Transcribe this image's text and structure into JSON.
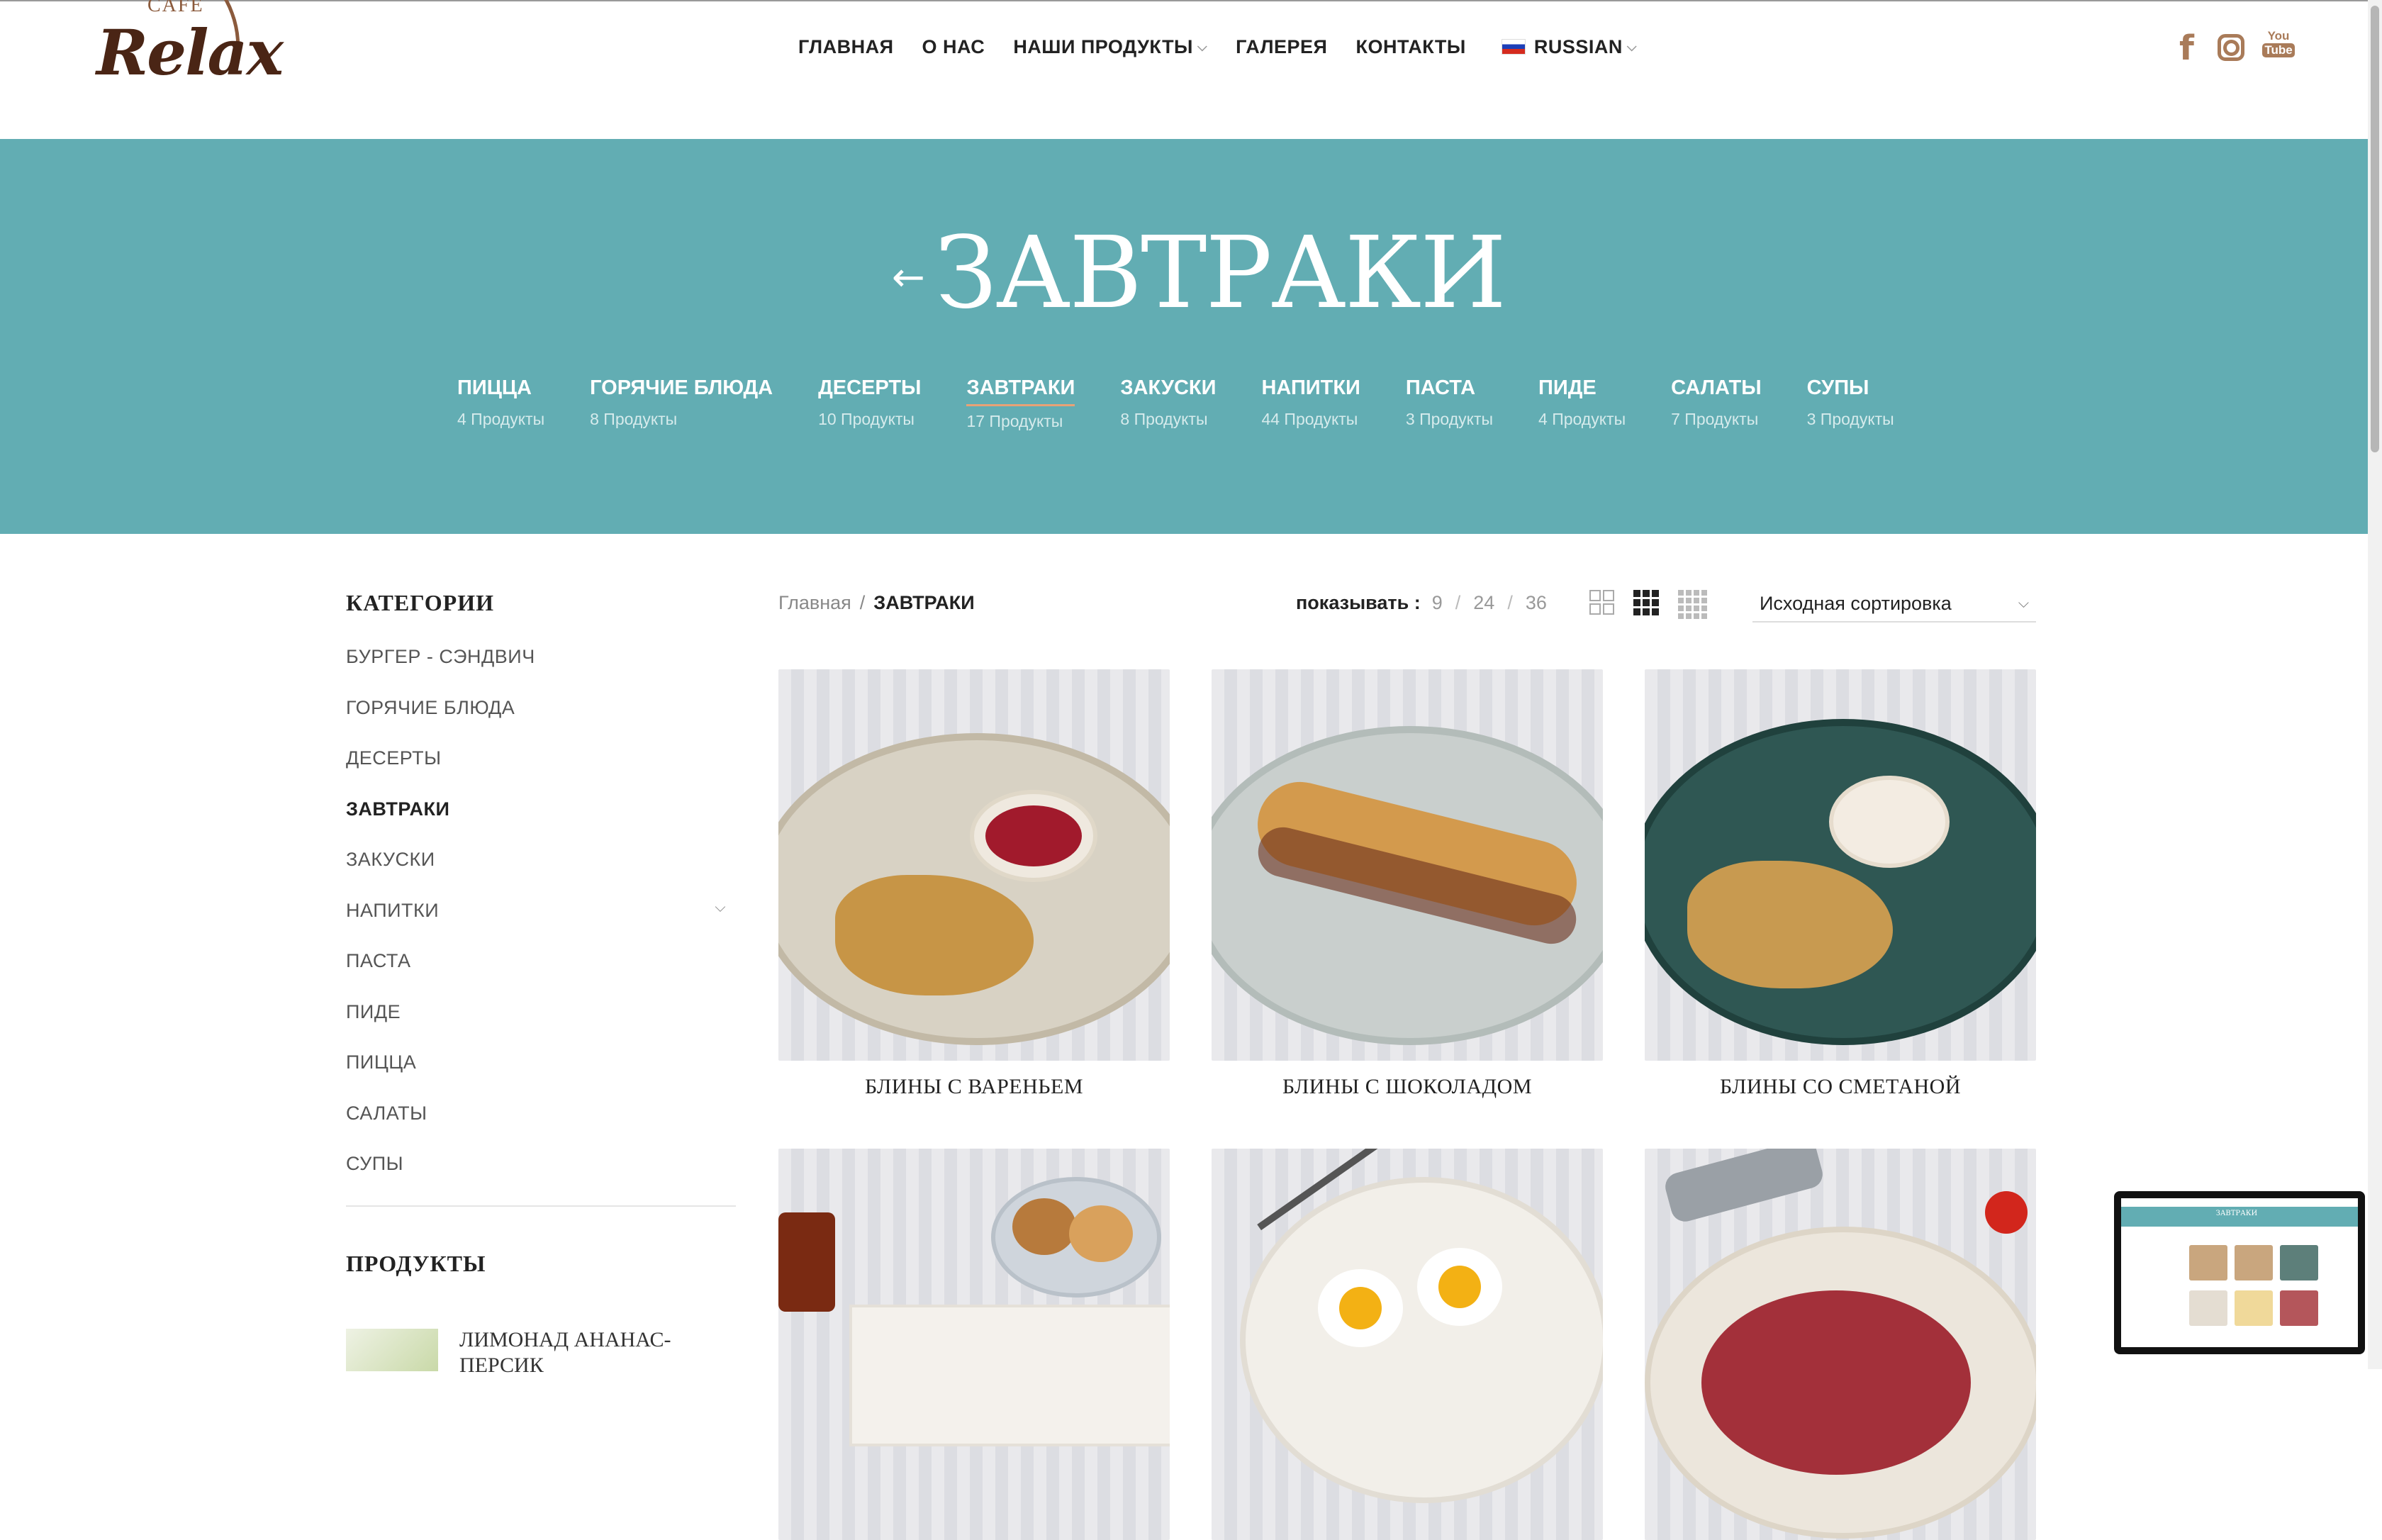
{
  "header": {
    "logo": {
      "cafe": "CAFE",
      "word": "Relax"
    },
    "nav": [
      {
        "label": "ГЛАВНАЯ",
        "has_dropdown": false
      },
      {
        "label": "О НАС",
        "has_dropdown": false
      },
      {
        "label": "НАШИ ПРОДУКТЫ",
        "has_dropdown": true
      },
      {
        "label": "ГАЛЕРЕЯ",
        "has_dropdown": false
      },
      {
        "label": "КОНТАКТЫ",
        "has_dropdown": false
      }
    ],
    "language": "RUSSIAN",
    "social": [
      {
        "icon": "facebook-icon",
        "glyph": "f"
      },
      {
        "icon": "instagram-icon"
      },
      {
        "icon": "youtube-icon",
        "top": "You",
        "bottom": "Tube"
      }
    ],
    "accent_color": "#a97b59"
  },
  "hero": {
    "title": "ЗАВТРАКИ",
    "back_arrow": "←",
    "background": "#62adb3",
    "categories": [
      {
        "name": "ПИЦЦА",
        "count": "4 Продукты"
      },
      {
        "name": "ГОРЯЧИЕ БЛЮДА",
        "count": "8 Продукты"
      },
      {
        "name": "ДЕСЕРТЫ",
        "count": "10 Продукты"
      },
      {
        "name": "ЗАВТРАКИ",
        "count": "17 Продукты"
      },
      {
        "name": "ЗАКУСКИ",
        "count": "8 Продукты"
      },
      {
        "name": "НАПИТКИ",
        "count": "44 Продукты"
      },
      {
        "name": "ПАСТА",
        "count": "3 Продукты"
      },
      {
        "name": "ПИДЕ",
        "count": "4 Продукты"
      },
      {
        "name": "САЛАТЫ",
        "count": "7 Продукты"
      },
      {
        "name": "СУПЫ",
        "count": "3 Продукты"
      }
    ],
    "active_category": "ЗАВТРАКИ"
  },
  "sidebar": {
    "categories_title": "КАТЕГОРИИ",
    "items": [
      {
        "label": "БУРГЕР - СЭНДВИЧ",
        "active": false,
        "expandable": false
      },
      {
        "label": "ГОРЯЧИЕ БЛЮДА",
        "active": false,
        "expandable": false
      },
      {
        "label": "ДЕСЕРТЫ",
        "active": false,
        "expandable": false
      },
      {
        "label": "ЗАВТРАКИ",
        "active": true,
        "expandable": false
      },
      {
        "label": "ЗАКУСКИ",
        "active": false,
        "expandable": false
      },
      {
        "label": "НАПИТКИ",
        "active": false,
        "expandable": true
      },
      {
        "label": "ПАСТА",
        "active": false,
        "expandable": false
      },
      {
        "label": "ПИДЕ",
        "active": false,
        "expandable": false
      },
      {
        "label": "ПИЦЦА",
        "active": false,
        "expandable": false
      },
      {
        "label": "САЛАТЫ",
        "active": false,
        "expandable": false
      },
      {
        "label": "СУПЫ",
        "active": false,
        "expandable": false
      }
    ],
    "products_title": "ПРОДУКТЫ",
    "product_preview": "ЛИМОНАД АНАНАС-ПЕРСИК"
  },
  "toolbar": {
    "breadcrumb": {
      "home": "Главная",
      "separator": "/",
      "current": "ЗАВТРАКИ"
    },
    "show_label": "показывать :",
    "show_options": [
      "9",
      "24",
      "36"
    ],
    "sort_label": "Исходная сортировка"
  },
  "products": [
    {
      "title": "БЛИНЫ С ВАРЕНЬЕМ",
      "plate": "#d8d2c4"
    },
    {
      "title": "БЛИНЫ С ШОКОЛАДОМ",
      "plate": "#c9cfcd"
    },
    {
      "title": "БЛИНЫ СО СМЕТАНОЙ",
      "plate": "#2f5753"
    },
    {
      "title": "",
      "plate": "#ede8e0"
    },
    {
      "title": "",
      "plate": "#f2efe9"
    },
    {
      "title": "",
      "plate": "#ece6dc"
    }
  ],
  "mini_preview": {
    "title": "ЗАВТРАКИ"
  }
}
